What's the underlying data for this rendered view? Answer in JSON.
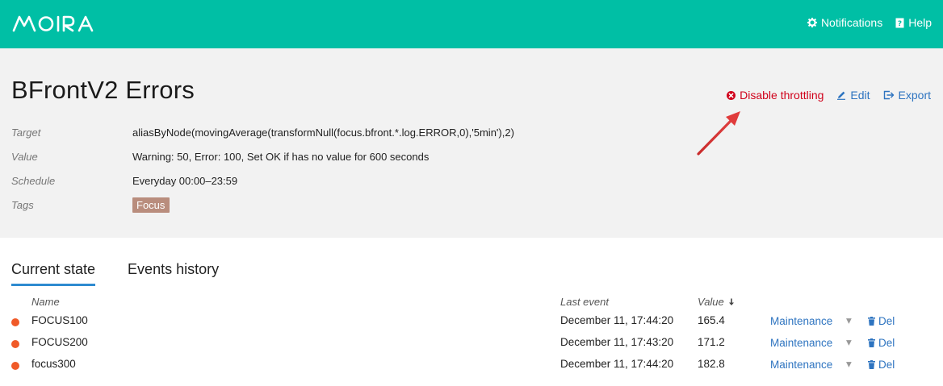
{
  "header": {
    "logo_text": "MOIRA",
    "nav": [
      {
        "label": "Notifications",
        "icon": "gear-icon"
      },
      {
        "label": "Help",
        "icon": "help-book-icon"
      }
    ],
    "brand_color": "#00bfa5"
  },
  "trigger": {
    "title": "BFrontV2 Errors",
    "actions": {
      "disable_throttling": "Disable throttling",
      "edit": "Edit",
      "export": "Export"
    },
    "fields": {
      "target_label": "Target",
      "target_value": "aliasByNode(movingAverage(transformNull(focus.bfront.*.log.ERROR,0),'5min'),2)",
      "value_label": "Value",
      "value_value": "Warning: 50, Error: 100, Set OK if has no value for 600 seconds",
      "schedule_label": "Schedule",
      "schedule_value": "Everyday 00:00–23:59",
      "tags_label": "Tags",
      "tags": [
        "Focus"
      ]
    }
  },
  "tabs": [
    {
      "label": "Current state",
      "active": true
    },
    {
      "label": "Events history",
      "active": false
    }
  ],
  "table": {
    "headers": {
      "name": "Name",
      "last_event": "Last event",
      "value": "Value"
    },
    "rows": [
      {
        "name": "FOCUS100",
        "last_event": "December 11, 17:44:20",
        "value": "165.4",
        "maintenance": "Maintenance",
        "del": "Del",
        "status_color": "#f05a28"
      },
      {
        "name": "FOCUS200",
        "last_event": "December 11, 17:43:20",
        "value": "171.2",
        "maintenance": "Maintenance",
        "del": "Del",
        "status_color": "#f05a28"
      },
      {
        "name": "focus300",
        "last_event": "December 11, 17:44:20",
        "value": "182.8",
        "maintenance": "Maintenance",
        "del": "Del",
        "status_color": "#f05a28"
      }
    ]
  }
}
